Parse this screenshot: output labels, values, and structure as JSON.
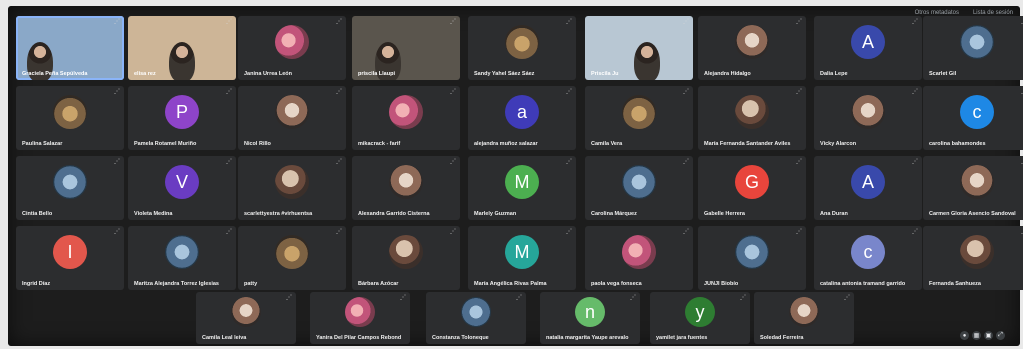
{
  "topbar": {
    "left_label": "Otros metadatos",
    "right_label": "Lista de sesión"
  },
  "participants": [
    {
      "name": "Graciela Peña Sepúlveda",
      "type": "video"
    },
    {
      "name": "elisa rez",
      "type": "video"
    },
    {
      "name": "Janina Urrea León",
      "type": "photo"
    },
    {
      "name": "priscila Llaupi",
      "type": "video"
    },
    {
      "name": "Sandy Yahel Sáez Sáez",
      "type": "photo"
    },
    {
      "name": "Priscila Ju",
      "type": "video"
    },
    {
      "name": "Alejandra Hidalgo",
      "type": "photo"
    },
    {
      "name": "Dalia Lepe",
      "type": "letter",
      "letter": "A",
      "color": "#3949ab"
    },
    {
      "name": "Scarlet Gil",
      "type": "photo"
    },
    {
      "name": "Paulina Salazar",
      "type": "photo"
    },
    {
      "name": "Pamela Rotamel Muriño",
      "type": "letter",
      "letter": "P",
      "color": "#8e44c9"
    },
    {
      "name": "Nicol Rillo",
      "type": "photo"
    },
    {
      "name": "mikacrack - farif",
      "type": "photo"
    },
    {
      "name": "alejandra muñoz salazar",
      "type": "letter",
      "letter": "a",
      "color": "#3f3bb8"
    },
    {
      "name": "Camila Vera",
      "type": "photo"
    },
    {
      "name": "María Fernanda Santander Aviles",
      "type": "photo"
    },
    {
      "name": "Vicky Alarcon",
      "type": "photo"
    },
    {
      "name": "carolina bahamondes",
      "type": "letter",
      "letter": "c",
      "color": "#1e88e5"
    },
    {
      "name": "Cintia Bello",
      "type": "photo"
    },
    {
      "name": "Violeta Medina",
      "type": "letter",
      "letter": "V",
      "color": "#6a3cc2"
    },
    {
      "name": "scarlettyestra #virhuentsa",
      "type": "photo"
    },
    {
      "name": "Alexandra Garrido Cisterna",
      "type": "photo"
    },
    {
      "name": "Marlely Guzman",
      "type": "letter",
      "letter": "M",
      "color": "#4caf50"
    },
    {
      "name": "Carolina Márquez",
      "type": "photo"
    },
    {
      "name": "Gabelle Herrera",
      "type": "letter",
      "letter": "G",
      "color": "#e8453c"
    },
    {
      "name": "Ana Duran",
      "type": "letter",
      "letter": "A",
      "color": "#3949ab"
    },
    {
      "name": "Carmen Gloria Asencio Sandoval",
      "type": "photo"
    },
    {
      "name": "Ingrid Díaz",
      "type": "letter",
      "letter": "I",
      "color": "#e2574c"
    },
    {
      "name": "Maritza Alejandra Torrez Iglesias",
      "type": "photo"
    },
    {
      "name": "patty",
      "type": "photo"
    },
    {
      "name": "Bárbara Azócar",
      "type": "photo"
    },
    {
      "name": "María Angélica Rivas Palma",
      "type": "letter",
      "letter": "M",
      "color": "#26a69a"
    },
    {
      "name": "paola vega fonseca",
      "type": "photo"
    },
    {
      "name": "JUNJI Biobío",
      "type": "photo"
    },
    {
      "name": "catalina antonia tramand garrido",
      "type": "letter",
      "letter": "c",
      "color": "#7986cb"
    },
    {
      "name": "Fernanda Sanhueza",
      "type": "photo"
    },
    {
      "name": "Camila Leal leiva",
      "type": "photo"
    },
    {
      "name": "Yanira Del Pilar Campos Rebond",
      "type": "photo"
    },
    {
      "name": "Constanza Toloneque",
      "type": "photo"
    },
    {
      "name": "natalia margarita Yaupe arevalo",
      "type": "letter",
      "letter": "n",
      "color": "#66bb6a"
    },
    {
      "name": "yamilet jara fuentes",
      "type": "letter",
      "letter": "y",
      "color": "#2e7d32"
    },
    {
      "name": "Soledad Ferreira",
      "type": "photo"
    }
  ]
}
